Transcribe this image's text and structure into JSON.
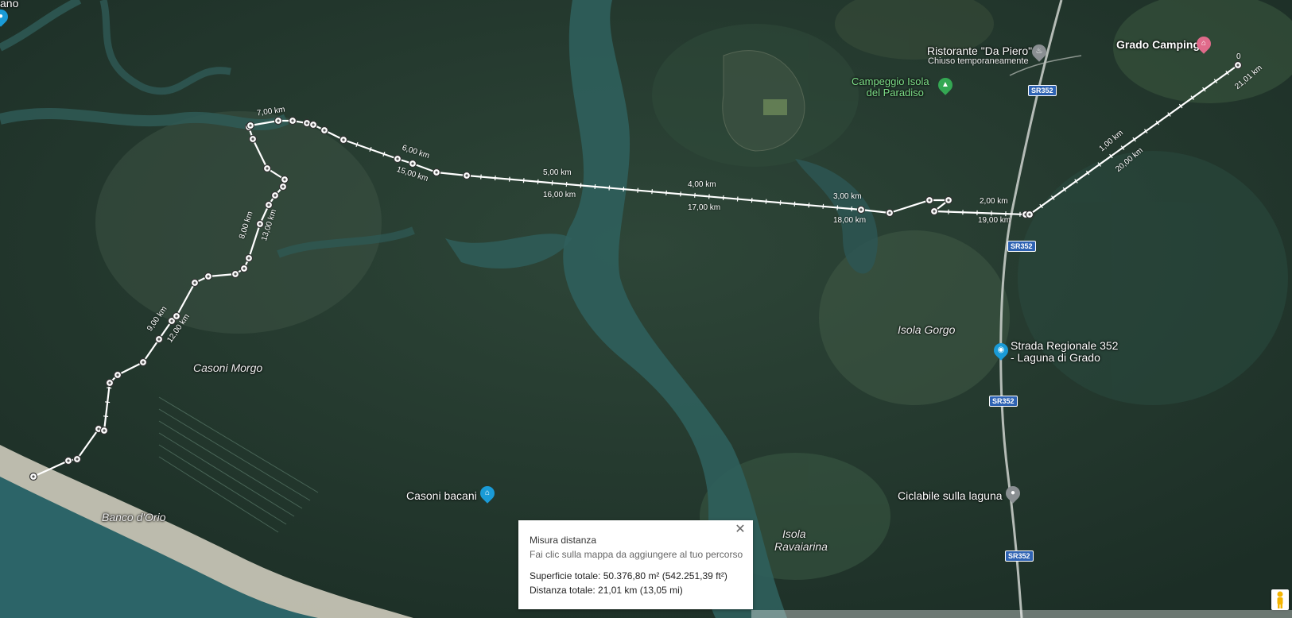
{
  "places": {
    "grado_camping": "Grado Camping",
    "ristorante": "Ristorante \"Da Piero\"",
    "ristorante_status": "Chiuso temporaneamente",
    "campeggio_line1": "Campeggio Isola",
    "campeggio_line2": "del Paradiso",
    "casoni_morgo": "Casoni Morgo",
    "isola_gorgo": "Isola Gorgo",
    "strada_line1": "Strada Regionale 352",
    "strada_line2": "- Laguna di Grado",
    "casoni_bacani": "Casoni bacani",
    "ciclabile": "Ciclabile sulla laguna",
    "isola_ravaiarina_1": "Isola",
    "isola_ravaiarina_2": "Ravaiarina",
    "banco_dorio": "Banco d'Orio",
    "top_left_fragment": "ano"
  },
  "roads": [
    "SR352",
    "SR352",
    "SR352",
    "SR352"
  ],
  "route_labels": {
    "start_marker": "0",
    "km_21": "21,01 km",
    "km_1": "1,00 km",
    "km_20": "20,00 km",
    "km_2": "2,00 km",
    "km_19": "19,00 km",
    "km_3": "3,00 km",
    "km_18": "18,00 km",
    "km_4": "4,00 km",
    "km_17": "17,00 km",
    "km_5": "5,00 km",
    "km_16": "16,00 km",
    "km_6": "6,00 km",
    "km_15": "15,00 km",
    "km_7": "7,00 km",
    "km_8": "8,00 km",
    "km_13": "13,00 km",
    "km_9": "9,00 km",
    "km_12": "12,00 km"
  },
  "panel": {
    "title": "Misura distanza",
    "hint": "Fai clic sulla mappa da aggiungere al tuo percorso",
    "area": "Superficie totale: 50.376,80 m² (542.251,39 ft²)",
    "distance": "Distanza totale: 21,01 km (13,05 mi)"
  },
  "icons": {
    "close": "close-icon",
    "pegman": "pegman-icon",
    "camping": "camping-icon",
    "restaurant": "restaurant-icon",
    "photo": "camera-icon",
    "pin": "location-pin-icon",
    "landmark": "landmark-icon"
  },
  "colors": {
    "route": "#ffffff",
    "water": "#2d5a57",
    "land": "#263d2f",
    "camping_green": "#34a853",
    "hotel_pink": "#e06b8b",
    "poi_blue": "#1a9bd7",
    "road_shield": "#2f63b3"
  }
}
